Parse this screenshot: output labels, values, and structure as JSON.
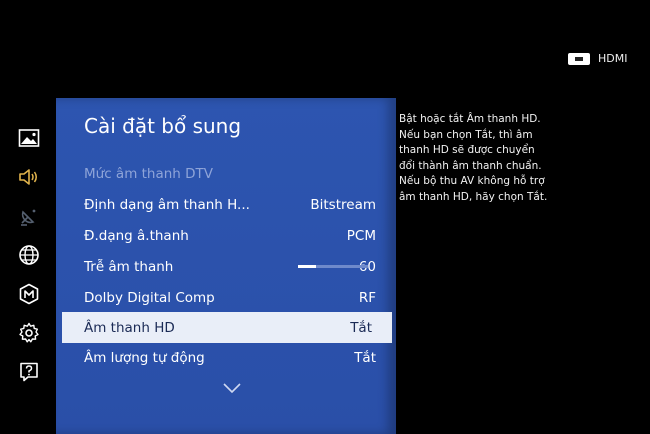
{
  "source": {
    "label": "HDMI",
    "icon": "hdmi-icon"
  },
  "sidebar": {
    "items": [
      {
        "name": "picture",
        "icon": "picture-icon"
      },
      {
        "name": "sound",
        "icon": "sound-icon",
        "active": true,
        "color": "#e0b34c"
      },
      {
        "name": "broadcast",
        "icon": "satellite-icon",
        "disabled": true
      },
      {
        "name": "network",
        "icon": "globe-icon"
      },
      {
        "name": "system",
        "icon": "cube-icon"
      },
      {
        "name": "settings",
        "icon": "gear-icon"
      },
      {
        "name": "support",
        "icon": "help-icon"
      }
    ]
  },
  "panel": {
    "title": "Cài đặt bổ sung",
    "rows": [
      {
        "label": "Mức âm thanh DTV",
        "value": "",
        "disabled": true
      },
      {
        "label": "Định dạng âm thanh H...",
        "value": "Bitstream"
      },
      {
        "label": "Đ.dạng â.thanh",
        "value": "PCM"
      },
      {
        "label": "Trễ âm thanh",
        "value": "60",
        "slider_fraction": 0.25
      },
      {
        "label": "Dolby Digital Comp",
        "value": "RF"
      },
      {
        "label": "Âm thanh HD",
        "value": "Tắt",
        "selected": true
      },
      {
        "label": "Âm lượng tự động",
        "value": "Tắt"
      }
    ],
    "more_icon": "chevron-down-icon"
  },
  "help": {
    "text": "Bật hoặc tắt Âm thanh HD. Nếu bạn chọn Tắt, thì âm thanh HD sẽ được chuyển đổi thành âm thanh chuẩn. Nếu bộ thu AV không hỗ trợ âm thanh HD, hãy chọn Tắt."
  },
  "colors": {
    "panel": "#2a4fa8",
    "selected_bg": "#e9eef8",
    "accent": "#e0b34c"
  }
}
